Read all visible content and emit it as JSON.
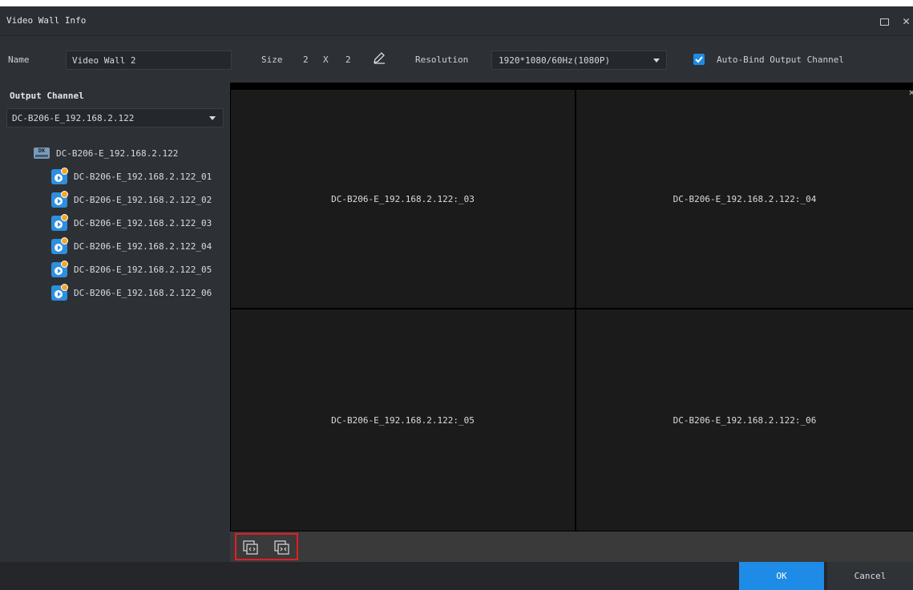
{
  "window": {
    "title": "Video Wall  Info"
  },
  "config": {
    "name_label": "Name",
    "name_value": "Video Wall 2",
    "size_label": "Size",
    "size_rows": "2",
    "size_sep": "X",
    "size_cols": "2",
    "resolution_label": "Resolution",
    "resolution_value": "1920*1080/60Hz(1080P)",
    "auto_bind_checked": true,
    "auto_bind_label": "Auto-Bind Output Channel"
  },
  "left_panel": {
    "title": "Output Channel",
    "selected_device": "DC-B206-E_192.168.2.122",
    "device": {
      "label": "DC-B206-E_192.168.2.122",
      "icon": "decoder-device-icon",
      "icon_text": "DK"
    },
    "channels": [
      "DC-B206-E_192.168.2.122_01",
      "DC-B206-E_192.168.2.122_02",
      "DC-B206-E_192.168.2.122_03",
      "DC-B206-E_192.168.2.122_04",
      "DC-B206-E_192.168.2.122_05",
      "DC-B206-E_192.168.2.122_06"
    ]
  },
  "wall": {
    "cells": [
      "DC-B206-E_192.168.2.122:_03",
      "DC-B206-E_192.168.2.122:_04",
      "DC-B206-E_192.168.2.122:_05",
      "DC-B206-E_192.168.2.122:_06"
    ]
  },
  "toolbar": {
    "tools": [
      "unbind-screens-icon",
      "bind-screens-icon"
    ]
  },
  "footer": {
    "ok_label": "OK",
    "cancel_label": "Cancel"
  },
  "colors": {
    "accent": "#1e8be6",
    "highlight_border": "#e21f26",
    "channel_badge": "#f6a623"
  }
}
